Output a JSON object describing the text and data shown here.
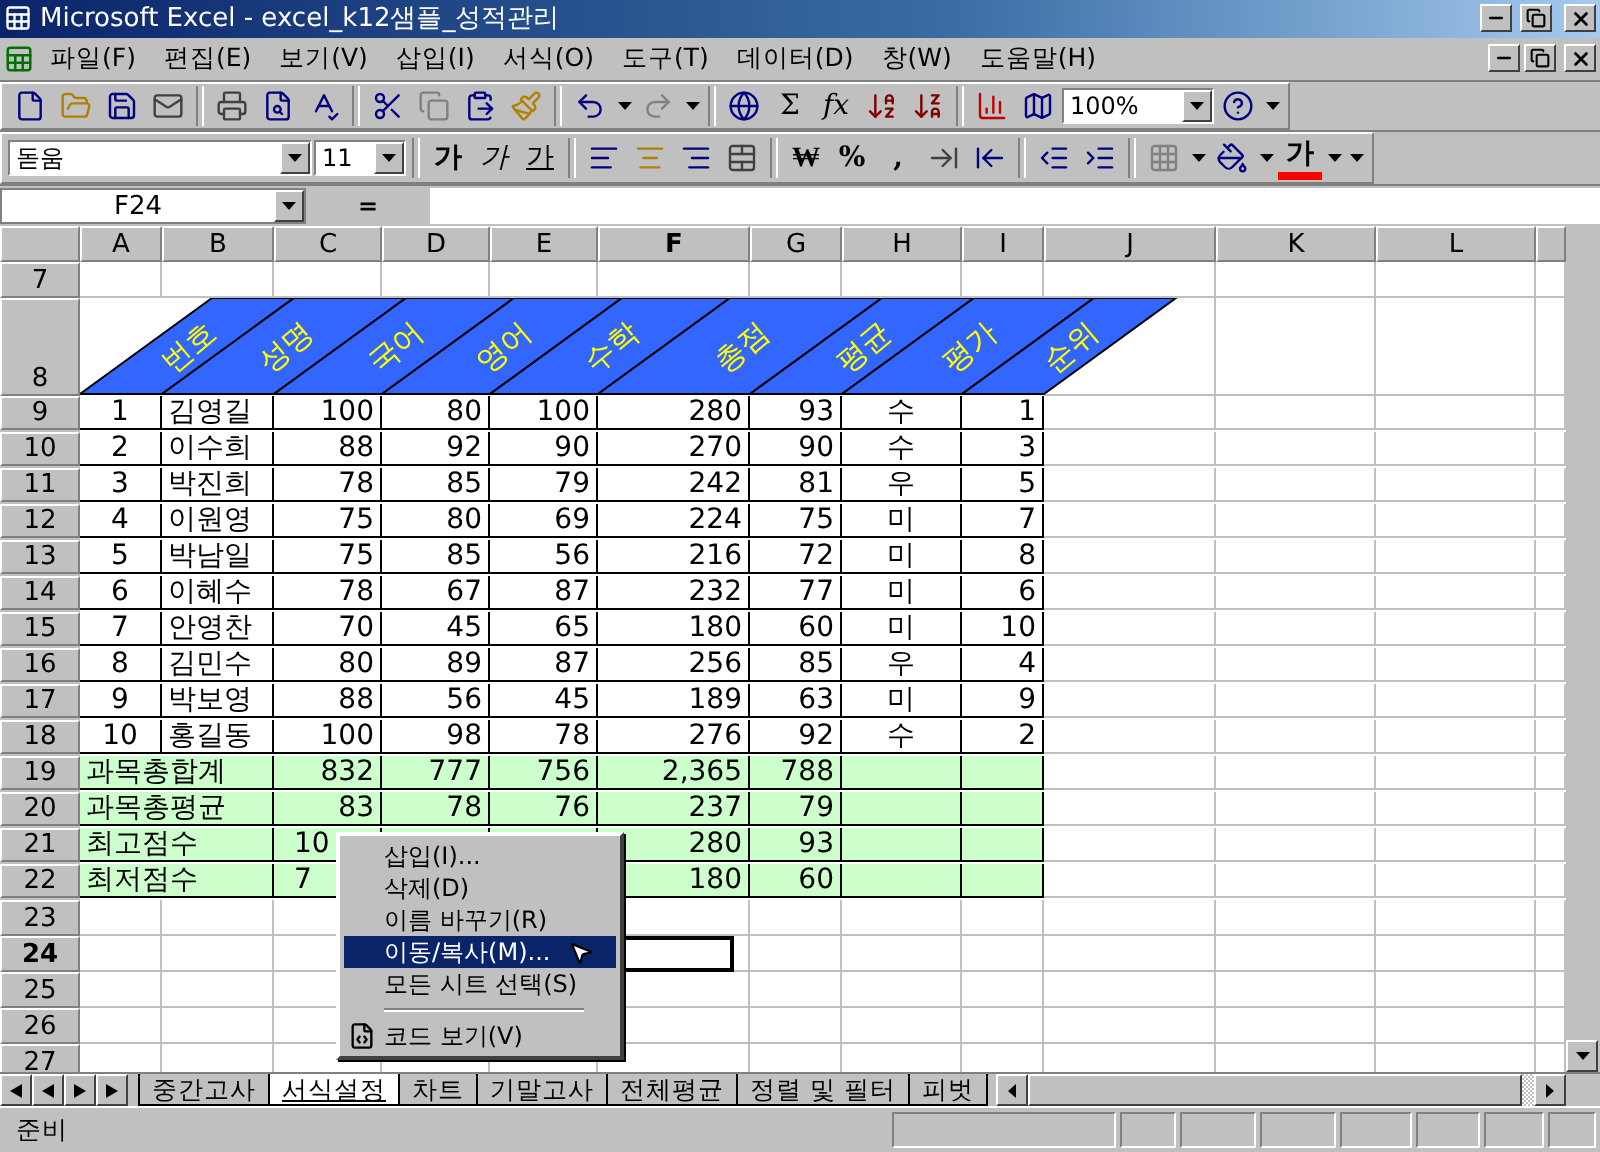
{
  "window": {
    "title": "Microsoft Excel - excel_k12샘플_성적관리"
  },
  "menu": [
    "파일(F)",
    "편집(E)",
    "보기(V)",
    "삽입(I)",
    "서식(O)",
    "도구(T)",
    "데이터(D)",
    "창(W)",
    "도움말(H)"
  ],
  "standard_toolbar": [
    {
      "kind": "icon"
    },
    {
      "kind": "icon"
    },
    {
      "kind": "icon"
    },
    {
      "kind": "icon"
    },
    {
      "kind": "sep"
    },
    {
      "kind": "icon"
    },
    {
      "kind": "icon"
    },
    {
      "kind": "icon"
    },
    {
      "kind": "sep"
    },
    {
      "kind": "icon"
    },
    {
      "kind": "icon"
    },
    {
      "kind": "icon"
    },
    {
      "kind": "icon"
    },
    {
      "kind": "sep"
    },
    {
      "kind": "icon"
    },
    {
      "kind": "dropdown"
    },
    {
      "kind": "icon"
    },
    {
      "kind": "dropdown"
    },
    {
      "kind": "sep"
    },
    {
      "kind": "icon"
    },
    {
      "kind": "text",
      "text": "Σ"
    },
    {
      "kind": "italic-text",
      "text": "fx"
    },
    {
      "kind": "icon"
    },
    {
      "kind": "icon"
    },
    {
      "kind": "sep"
    },
    {
      "kind": "icon"
    },
    {
      "kind": "icon"
    },
    {
      "kind": "combo",
      "text": "100%"
    },
    {
      "kind": "icon"
    },
    {
      "kind": "dropdown"
    }
  ],
  "formatting_toolbar": [
    {
      "kind": "combo",
      "text": "돋움"
    },
    {
      "kind": "combo",
      "text": "11"
    },
    {
      "kind": "sep"
    },
    {
      "kind": "bold-text",
      "text": "가"
    },
    {
      "kind": "italic-text",
      "text": "가"
    },
    {
      "kind": "underline-text",
      "text": "가"
    },
    {
      "kind": "sep"
    },
    {
      "kind": "icon"
    },
    {
      "kind": "icon"
    },
    {
      "kind": "icon"
    },
    {
      "kind": "icon"
    },
    {
      "kind": "sep"
    },
    {
      "kind": "bold-text",
      "text": "₩"
    },
    {
      "kind": "bold-text",
      "text": "%"
    },
    {
      "kind": "bold-text",
      "text": ","
    },
    {
      "kind": "icon"
    },
    {
      "kind": "icon"
    },
    {
      "kind": "sep"
    },
    {
      "kind": "icon"
    },
    {
      "kind": "icon"
    },
    {
      "kind": "sep"
    },
    {
      "kind": "icon"
    },
    {
      "kind": "dropdown"
    },
    {
      "kind": "icon"
    },
    {
      "kind": "dropdown"
    },
    {
      "kind": "color-text",
      "text": "가"
    },
    {
      "kind": "dropdown"
    },
    {
      "kind": "dropdown"
    }
  ],
  "formula_bar": {
    "name_box": "F24",
    "equals": "="
  },
  "columns": [
    {
      "label": "A",
      "selected": false
    },
    {
      "label": "B",
      "selected": false
    },
    {
      "label": "C",
      "selected": false
    },
    {
      "label": "D",
      "selected": false
    },
    {
      "label": "E",
      "selected": false
    },
    {
      "label": "F",
      "selected": true
    },
    {
      "label": "G",
      "selected": false
    },
    {
      "label": "H",
      "selected": false
    },
    {
      "label": "I",
      "selected": false
    },
    {
      "label": "J",
      "selected": false
    },
    {
      "label": "K",
      "selected": false
    },
    {
      "label": "L",
      "selected": false
    }
  ],
  "header_labels": [
    "번호",
    "성명",
    "국어",
    "영어",
    "수학",
    "총점",
    "평균",
    "평가",
    "순위"
  ],
  "rows": [
    {
      "label": "7",
      "kind": "empty",
      "selected": false
    },
    {
      "label": "8",
      "kind": "header",
      "selected": false
    },
    {
      "label": "9",
      "kind": "data",
      "selected": false,
      "cells": [
        "1",
        "김영길",
        "100",
        "80",
        "100",
        "280",
        "93",
        "수",
        "1"
      ]
    },
    {
      "label": "10",
      "kind": "data",
      "selected": false,
      "cells": [
        "2",
        "이수희",
        "88",
        "92",
        "90",
        "270",
        "90",
        "수",
        "3"
      ]
    },
    {
      "label": "11",
      "kind": "data",
      "selected": false,
      "cells": [
        "3",
        "박진희",
        "78",
        "85",
        "79",
        "242",
        "81",
        "우",
        "5"
      ]
    },
    {
      "label": "12",
      "kind": "data",
      "selected": false,
      "cells": [
        "4",
        "이원영",
        "75",
        "80",
        "69",
        "224",
        "75",
        "미",
        "7"
      ]
    },
    {
      "label": "13",
      "kind": "data",
      "selected": false,
      "cells": [
        "5",
        "박남일",
        "75",
        "85",
        "56",
        "216",
        "72",
        "미",
        "8"
      ]
    },
    {
      "label": "14",
      "kind": "data",
      "selected": false,
      "cells": [
        "6",
        "이혜수",
        "78",
        "67",
        "87",
        "232",
        "77",
        "미",
        "6"
      ]
    },
    {
      "label": "15",
      "kind": "data",
      "selected": false,
      "cells": [
        "7",
        "안영찬",
        "70",
        "45",
        "65",
        "180",
        "60",
        "미",
        "10"
      ]
    },
    {
      "label": "16",
      "kind": "data",
      "selected": false,
      "cells": [
        "8",
        "김민수",
        "80",
        "89",
        "87",
        "256",
        "85",
        "우",
        "4"
      ]
    },
    {
      "label": "17",
      "kind": "data",
      "selected": false,
      "cells": [
        "9",
        "박보영",
        "88",
        "56",
        "45",
        "189",
        "63",
        "미",
        "9"
      ]
    },
    {
      "label": "18",
      "kind": "data",
      "selected": false,
      "cells": [
        "10",
        "홍길동",
        "100",
        "98",
        "78",
        "276",
        "92",
        "수",
        "2"
      ]
    },
    {
      "label": "19",
      "kind": "summary",
      "selected": false,
      "title": "과목총합계",
      "left_values": [
        "832",
        "777",
        "756"
      ],
      "right_values": [
        "2,365",
        "788"
      ]
    },
    {
      "label": "20",
      "kind": "summary",
      "selected": false,
      "title": "과목총평균",
      "left_values": [
        "83",
        "78",
        "76"
      ],
      "right_values": [
        "237",
        "79"
      ]
    },
    {
      "label": "21",
      "kind": "summary",
      "selected": false,
      "title": "최고점수",
      "left_values": [
        "10"
      ],
      "right_values": [
        "280",
        "93"
      ]
    },
    {
      "label": "22",
      "kind": "summary",
      "selected": false,
      "title": "최저점수",
      "left_values": [
        "7"
      ],
      "right_values": [
        "180",
        "60"
      ]
    },
    {
      "label": "23",
      "kind": "empty",
      "selected": false
    },
    {
      "label": "24",
      "kind": "empty",
      "selected": true
    },
    {
      "label": "25",
      "kind": "empty",
      "selected": false
    },
    {
      "label": "26",
      "kind": "empty",
      "selected": false
    },
    {
      "label": "27",
      "kind": "empty",
      "selected": false
    }
  ],
  "context_menu": [
    {
      "kind": "item",
      "label": "삽입(I)...",
      "selected": false
    },
    {
      "kind": "item",
      "label": "삭제(D)",
      "selected": false
    },
    {
      "kind": "item",
      "label": "이름 바꾸기(R)",
      "selected": false
    },
    {
      "kind": "item",
      "label": "이동/복사(M)...",
      "selected": true
    },
    {
      "kind": "item",
      "label": "모든 시트 선택(S)",
      "selected": false
    },
    {
      "kind": "separator"
    },
    {
      "kind": "code",
      "label": "코드 보기(V)",
      "selected": false
    }
  ],
  "sheet_tabs": [
    {
      "label": "중간고사",
      "selected": false
    },
    {
      "label": "서식설정",
      "selected": true
    },
    {
      "label": "차트",
      "selected": false
    },
    {
      "label": "기말고사",
      "selected": false
    },
    {
      "label": "전체평균",
      "selected": false
    },
    {
      "label": "정렬 및 필터",
      "selected": false
    },
    {
      "label": "피벗",
      "selected": false
    }
  ],
  "status_bar": {
    "text": "준비"
  }
}
